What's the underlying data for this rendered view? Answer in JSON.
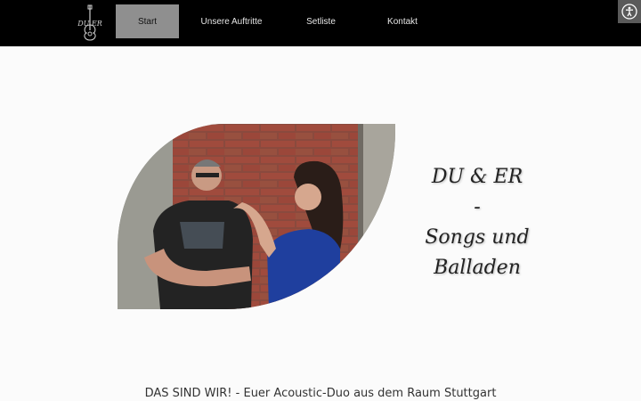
{
  "header": {
    "logo": {
      "text": "DU ER",
      "icon": "guitar-logo"
    },
    "nav": [
      {
        "label": "Start",
        "active": true
      },
      {
        "label": "Unsere Auftritte",
        "active": false
      },
      {
        "label": "Setliste",
        "active": false
      },
      {
        "label": "Kontakt",
        "active": false
      }
    ],
    "accessibility_icon": "accessibility-icon"
  },
  "hero": {
    "tagline": [
      "DU & ER",
      "-",
      "Songs und",
      "Balladen"
    ]
  },
  "intro": {
    "text": "DAS SIND WIR! - Euer Acoustic-Duo aus dem Raum Stuttgart"
  },
  "colors": {
    "header_bg": "#000000",
    "nav_active_bg": "#8f8f8f",
    "page_bg": "#fbfbfb",
    "accessibility_bg": "#5a5a5a"
  }
}
